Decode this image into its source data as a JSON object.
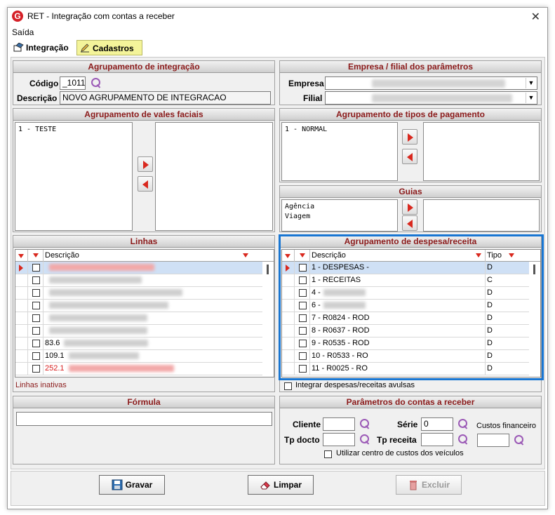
{
  "window": {
    "title": "RET - Integração com contas a receber",
    "logo": "G"
  },
  "menu": {
    "item": "Saída"
  },
  "tabs": [
    {
      "label": "Integração",
      "icon": "integration-icon"
    },
    {
      "label": "Cadastros",
      "icon": "edit-pencil-icon"
    }
  ],
  "agrupamento_integracao": {
    "title": "Agrupamento de integração",
    "codigo_label": "Código",
    "codigo_value": "_1011",
    "descricao_label": "Descrição",
    "descricao_value": "NOVO AGRUPAMENTO DE INTEGRACAO"
  },
  "empresa_filial": {
    "title": "Empresa / filial  dos parâmetros",
    "empresa_label": "Empresa",
    "filial_label": "Filial"
  },
  "vales_faciais": {
    "title": "Agrupamento de vales faciais",
    "items": [
      "1 - TESTE"
    ]
  },
  "tipos_pagamento": {
    "title": "Agrupamento de tipos de pagamento",
    "items": [
      "1 - NORMAL"
    ]
  },
  "guias": {
    "title": "Guias",
    "items": [
      "Agência",
      "Viagem"
    ]
  },
  "linhas": {
    "title": "Linhas",
    "column": "Descrição",
    "inactive_label": "Linhas inativas",
    "rows": [
      {
        "code": "",
        "red": true,
        "sel": true
      },
      {
        "code": "",
        "red": false
      },
      {
        "code": "",
        "red": false
      },
      {
        "code": "",
        "red": false
      },
      {
        "code": "",
        "red": false
      },
      {
        "code": "",
        "red": false
      },
      {
        "code": "83.6",
        "red": false
      },
      {
        "code": "109.1",
        "red": false
      },
      {
        "code": "252.1",
        "red": true
      }
    ]
  },
  "despesa_receita": {
    "title": "Agrupamento de despesa/receita",
    "col_descricao": "Descrição",
    "col_tipo": "Tipo",
    "rows": [
      {
        "desc": "1 - DESPESAS -",
        "tipo": "D",
        "sel": true
      },
      {
        "desc": "1 - RECEITAS",
        "tipo": "C"
      },
      {
        "desc": "4 -",
        "tipo": "D",
        "blur": true
      },
      {
        "desc": "6 -",
        "tipo": "D",
        "blur": true
      },
      {
        "desc": "7 - R0824 - ROD",
        "tipo": "D"
      },
      {
        "desc": "8 - R0637 - ROD",
        "tipo": "D"
      },
      {
        "desc": "9 - R0535 - ROD",
        "tipo": "D"
      },
      {
        "desc": "10 - R0533 - RO",
        "tipo": "D"
      },
      {
        "desc": "11 - R0025 - RO",
        "tipo": "D"
      }
    ],
    "avulsas_label": "Integrar despesas/receitas avulsas"
  },
  "formula": {
    "title": "Fórmula",
    "value": ""
  },
  "parametros": {
    "title": "Parâmetros do contas a receber",
    "cliente_label": "Cliente",
    "serie_label": "Série",
    "serie_value": "0",
    "custos_label": "Custos financeiro",
    "tpdocto_label": "Tp docto",
    "tpreceita_label": "Tp receita",
    "centro_label": "Utilizar centro de custos dos veículos"
  },
  "buttons": {
    "gravar": "Gravar",
    "limpar": "Limpar",
    "excluir": "Excluir"
  },
  "colors": {
    "accent_red": "#8b1a1a",
    "highlight": "#1976d2",
    "tab_active": "#f4f49a"
  }
}
